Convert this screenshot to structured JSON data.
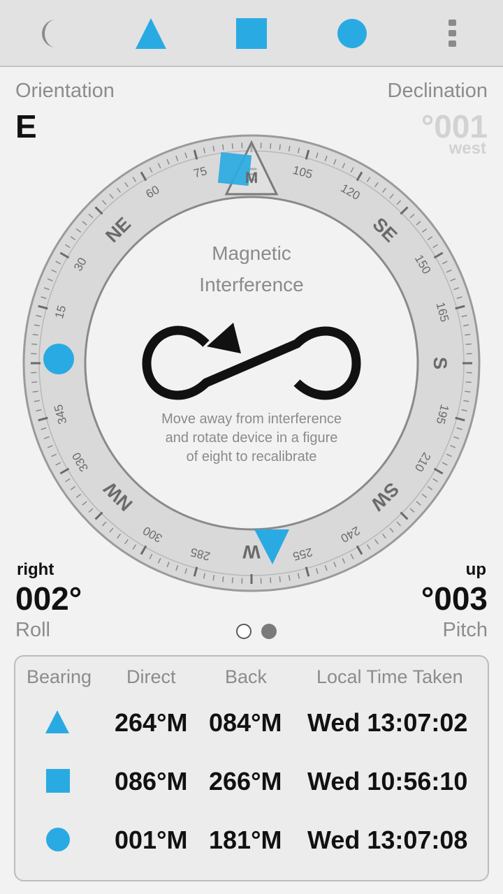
{
  "toolbar": {
    "items": [
      {
        "name": "night-mode-icon"
      },
      {
        "name": "triangle-marker-icon"
      },
      {
        "name": "square-marker-icon"
      },
      {
        "name": "circle-marker-icon"
      },
      {
        "name": "overflow-menu-icon"
      }
    ]
  },
  "colors": {
    "accent": "#2aaae2",
    "ring": "#d8d8d8",
    "text_dark": "#111111",
    "text_gray": "#8c8c8c"
  },
  "orientation": {
    "label": "Orientation",
    "value": "E"
  },
  "declination": {
    "label": "Declination",
    "value": "°001",
    "direction": "west"
  },
  "compass": {
    "lubber_label": "M",
    "cardinals": {
      "ne": "NE",
      "e": "E",
      "se": "SE",
      "s": "S",
      "sw": "SW",
      "w": "W",
      "nw": "NW"
    },
    "degree_labels": [
      "15",
      "30",
      "60",
      "75",
      "105",
      "120",
      "150",
      "165",
      "195",
      "210",
      "240",
      "255",
      "285",
      "300",
      "330",
      "345"
    ],
    "heading_deg": 90,
    "message_title_line1": "Magnetic",
    "message_title_line2": "Interference",
    "message_line1": "Move away from interference",
    "message_line2": "and rotate device in a figure",
    "message_line3": "of eight to recalibrate"
  },
  "roll": {
    "direction": "right",
    "value": "002°",
    "label": "Roll"
  },
  "pitch": {
    "direction": "up",
    "value": "°003",
    "label": "Pitch"
  },
  "pager": {
    "pages": 2,
    "current": 2
  },
  "bearings": {
    "headers": {
      "bearing": "Bearing",
      "direct": "Direct",
      "back": "Back",
      "time": "Local Time Taken"
    },
    "rows": [
      {
        "marker": "triangle",
        "direct": "264°M",
        "back": "084°M",
        "time": "Wed 13:07:02"
      },
      {
        "marker": "square",
        "direct": "086°M",
        "back": "266°M",
        "time": "Wed 10:56:10"
      },
      {
        "marker": "circle",
        "direct": "001°M",
        "back": "181°M",
        "time": "Wed 13:07:08"
      }
    ]
  }
}
